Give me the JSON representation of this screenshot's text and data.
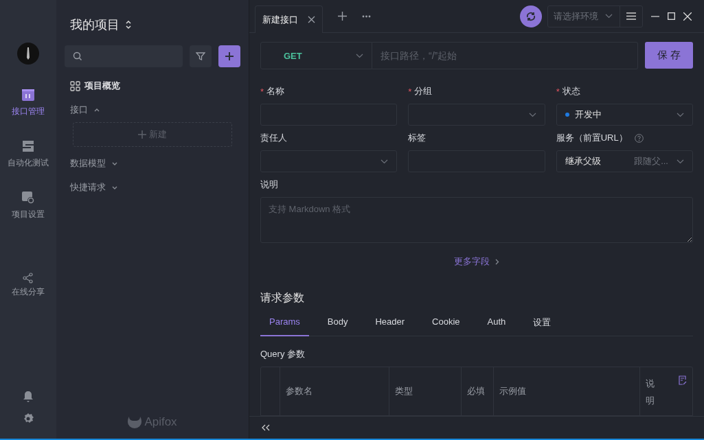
{
  "rail": {
    "nav": [
      {
        "label": "接口管理",
        "kind": "api",
        "selected": true
      },
      {
        "label": "自动化测试",
        "kind": "test",
        "selected": false
      },
      {
        "label": "项目设置",
        "kind": "settings",
        "selected": false
      }
    ],
    "share": {
      "label": "在线分享"
    }
  },
  "project": {
    "title": "我的项目",
    "tree": [
      {
        "label": "项目概览",
        "kind": "overview"
      },
      {
        "label": "接口",
        "kind": "group",
        "expanded": true,
        "new_label": "新建"
      },
      {
        "label": "数据模型",
        "kind": "group",
        "expanded": false
      },
      {
        "label": "快捷请求",
        "kind": "group",
        "expanded": false
      }
    ],
    "brand": "Apifox"
  },
  "tabs": [
    {
      "label": "新建接口",
      "selected": true
    }
  ],
  "environment": {
    "placeholder": "请选择环境"
  },
  "request": {
    "method": "GET",
    "url_placeholder": "接口路径，“/”起始",
    "save": "保 存"
  },
  "required_mark": "*",
  "fields": [
    {
      "label": "名称",
      "required": true,
      "kind": "input"
    },
    {
      "label": "分组",
      "required": true,
      "kind": "select"
    },
    {
      "label": "状态",
      "required": true,
      "kind": "status",
      "value": "开发中",
      "color": "#1f7ae0"
    },
    {
      "label": "责任人",
      "required": false,
      "kind": "select"
    },
    {
      "label": "标签",
      "required": false,
      "kind": "input"
    },
    {
      "label": "服务（前置URL）",
      "required": false,
      "kind": "service",
      "value": "继承父级",
      "hint": "跟随父..."
    }
  ],
  "description": {
    "label": "说明",
    "placeholder": "支持 Markdown 格式"
  },
  "more_fields": "更多字段",
  "params": {
    "title": "请求参数",
    "tabs": [
      {
        "label": "Params",
        "selected": true
      },
      {
        "label": "Body",
        "selected": false
      },
      {
        "label": "Header",
        "selected": false
      },
      {
        "label": "Cookie",
        "selected": false
      },
      {
        "label": "Auth",
        "selected": false
      },
      {
        "label": "设置",
        "selected": false
      }
    ],
    "query_title": "Query 参数",
    "columns": [
      "参数名",
      "类型",
      "必填",
      "示例值",
      "说明"
    ]
  }
}
